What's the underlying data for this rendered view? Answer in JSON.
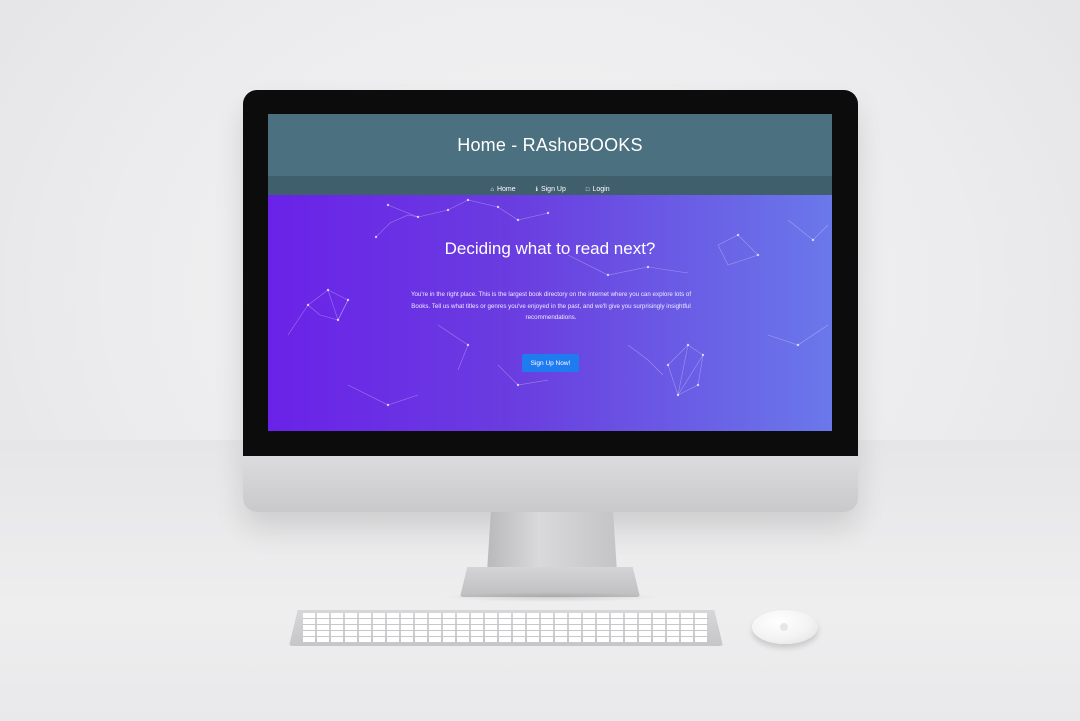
{
  "site": {
    "title": "Home - RAshoBOOKS"
  },
  "nav": {
    "items": [
      {
        "icon": "home-icon",
        "label": "Home"
      },
      {
        "icon": "info-icon",
        "label": "Sign Up"
      },
      {
        "icon": "login-icon",
        "label": "Login"
      }
    ]
  },
  "hero": {
    "heading": "Deciding what to read next?",
    "text": "You're in the right place. This is the largest book directory on the internet where you can explore lots of Books. Tell us what titles or genres you've enjoyed in the past, and we'll give you surprisingly insightful recommendations.",
    "button_label": "Sign Up Now!"
  },
  "colors": {
    "header_bg": "#4b7080",
    "nav_bg": "#405f6d",
    "hero_gradient_start": "#6a22e8",
    "hero_gradient_end": "#6a78ea",
    "button_bg": "#1e7bf0"
  }
}
